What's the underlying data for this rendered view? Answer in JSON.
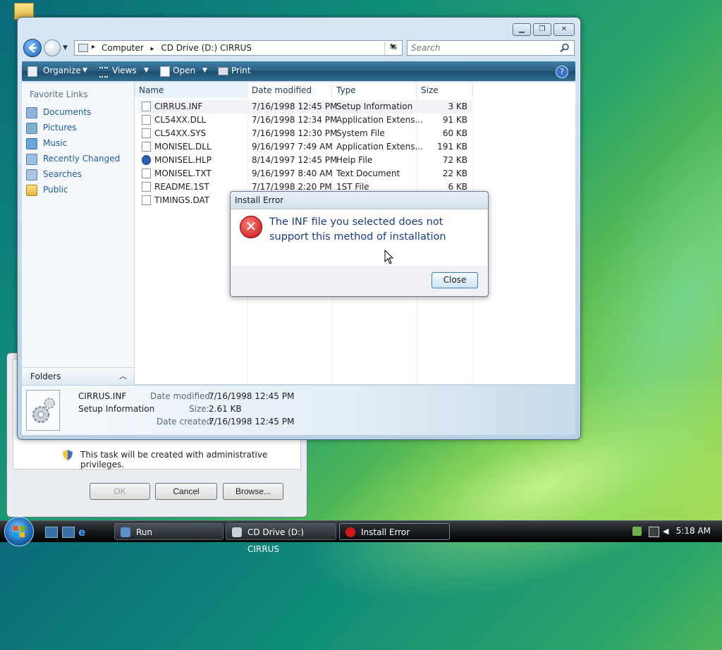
{
  "colors": {
    "accent": "#1f5c9e",
    "error": "#c01010",
    "message": "#1a3b8a"
  },
  "run_dialog": {
    "note": "This task will be created with administrative privileges.",
    "ok": "OK",
    "cancel": "Cancel",
    "browse": "Browse..."
  },
  "explorer": {
    "breadcrumb": [
      "Computer",
      "CD Drive (D:) CIRRUS"
    ],
    "search_placeholder": "Search",
    "toolbar": {
      "organize": "Organize",
      "views": "Views",
      "open": "Open",
      "print": "Print",
      "help_glyph": "?"
    },
    "favorite_links_title": "Favorite Links",
    "favorite_links": [
      "Documents",
      "Pictures",
      "Music",
      "Recently Changed",
      "Searches",
      "Public"
    ],
    "folders_label": "Folders",
    "columns": [
      "Name",
      "Date modified",
      "Type",
      "Size"
    ],
    "files": [
      {
        "name": "CIRRUS.INF",
        "modified": "7/16/1998 12:45 PM",
        "type": "Setup Information",
        "size": "3 KB"
      },
      {
        "name": "CL54XX.DLL",
        "modified": "7/16/1998 12:34 PM",
        "type": "Application Extens...",
        "size": "91 KB"
      },
      {
        "name": "CL54XX.SYS",
        "modified": "7/16/1998 12:30 PM",
        "type": "System File",
        "size": "60 KB"
      },
      {
        "name": "MONISEL.DLL",
        "modified": "9/16/1997 7:49 AM",
        "type": "Application Extens...",
        "size": "191 KB"
      },
      {
        "name": "MONISEL.HLP",
        "modified": "8/14/1997 12:45 PM",
        "type": "Help File",
        "size": "72 KB"
      },
      {
        "name": "MONISEL.TXT",
        "modified": "9/16/1997 8:40 AM",
        "type": "Text Document",
        "size": "22 KB"
      },
      {
        "name": "README.1ST",
        "modified": "7/17/1998 2:20 PM",
        "type": "1ST File",
        "size": "6 KB"
      },
      {
        "name": "TIMINGS.DAT",
        "modified": "",
        "type": "",
        "size": ""
      }
    ],
    "details": {
      "file_name": "CIRRUS.INF",
      "file_type": "Setup Information",
      "date_modified_label": "Date modified:",
      "date_modified": "7/16/1998 12:45 PM",
      "size_label": "Size:",
      "size": "2.61 KB",
      "date_created_label": "Date created:",
      "date_created": "7/16/1998 12:45 PM"
    }
  },
  "error_dialog": {
    "title": "Install Error",
    "message": "The INF file you selected does not support this method of installation",
    "close": "Close",
    "icon_glyph": "✕"
  },
  "taskbar": {
    "tasks": [
      "Run",
      "CD Drive (D:) CIRRUS",
      "Install Error"
    ],
    "clock": "5:18 AM"
  }
}
